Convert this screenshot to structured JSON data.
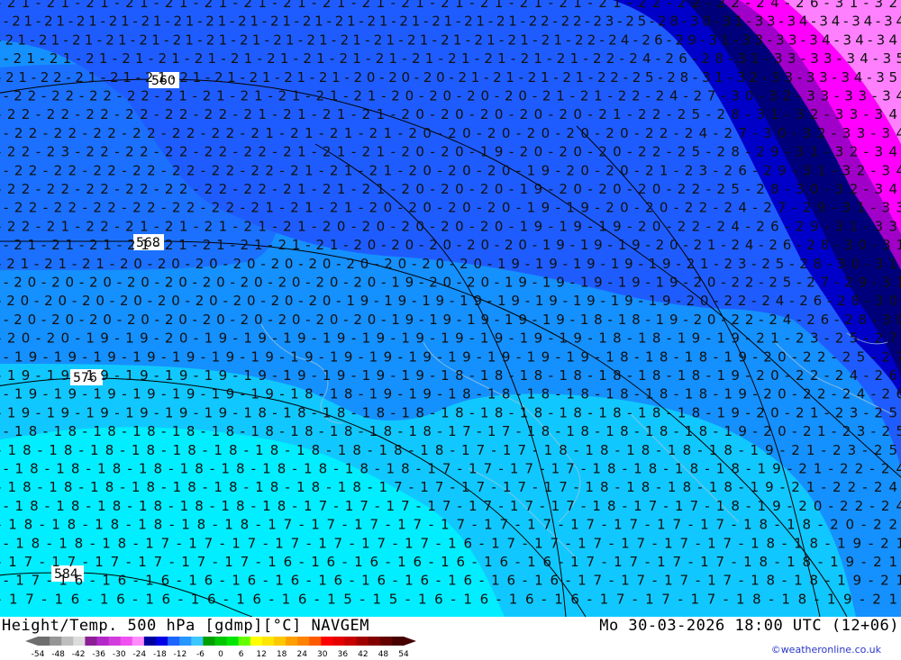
{
  "map": {
    "background_colors": {
      "m24": "#00007a",
      "m22": "#0000c8",
      "m20": "#1f5cff",
      "m18": "#1590ff",
      "m16": "#10c8ff",
      "m14": "#00eeff",
      "m26": "#a000c8",
      "m28": "#ff00ff",
      "m30": "#ff80ff"
    },
    "height_contours": [
      {
        "label": "560"
      },
      {
        "label": "568"
      },
      {
        "label": "576"
      },
      {
        "label": "584"
      }
    ],
    "temperature_rows": [
      "-21-21-21-21-21-21-21-21-21-21-21-21-21-21-21-21-22-22-22-24-26-31-32",
      "-21-21-21-21-21-21-21-21-21-21-21-21-21-21-21-21-22-22-23-25-28-30-31-33-34-34-34-34",
      "-21-21-21-21-21-21-21-21-21-21-21-21-21-21-21-21-21-22-24-26-29-31-33-33-34-34-34",
      "-21-21-21-21-21-21-21-21-21-21-21-21-21-21-21-21-22-24-26-28-31-33-33-34-35",
      "-21-22-21-21-21-21-21-21-21-21-20-20-20-21-21-21-21-22-25-28-31-32-33-33-34-35",
      "-22-22-22-22-21-21-21-21-21-21-20-20-20-20-21-21-22-24-27-30-32-33-33-34",
      "-22-22-22-22-22-22-21-21-21-21-20-20-20-20-20-21-22-25-28-31-32-33-34",
      "-22-22-22-22-22-22-21-21-21-21-20-20-20-20-20-20-22-24-27-30-32-33-34",
      "-22-23-22-22-22-22-22-21-21-21-20-20-19-20-20-20-22-25-28-29-31-32-34",
      "-22-22-22-22-22-22-22-21-21-21-20-20-20-19-20-20-21-23-26-29-31-32-34",
      "-22-22-22-22-22-22-22-21-21-21-20-20-20-19-20-20-20-22-25-28-30-32-34",
      "-22-22-22-22-22-22-21-21-21-20-20-20-20-19-19-20-20-22-24-27-29-31-33",
      "-22-21-22-21-21-21-21-21-20-20-20-20-20-19-19-19-20-22-24-26-29-31-33",
      "-21-21-21-21-21-21-21-21-21-20-20-20-20-20-19-19-19-20-21-24-26-28-30-31",
      "-21-21-21-20-20-20-20-20-20-20-20-20-20-19-19-19-19-19-21-23-25-28-30-31",
      "-20-20-20-20-20-20-20-20-20-20-19-20-20-19-19-19-19-19-20-22-25-27-29-31",
      "-20-20-20-20-20-20-20-20-20-19-19-19-19-19-19-19-19-19-20-22-24-26-28-30",
      "-20-20-20-20-20-20-20-20-20-20-19-19-19-19-19-18-18-19-20-22-24-26-28-30",
      "-20-20-19-19-20-19-19-19-19-19-19-19-19-19-19-18-18-19-19-21-23-25-27",
      "-19-19-19-19-19-19-19-19-19-19-19-19-19-19-19-18-18-18-19-20-22-25-27",
      "-19-19-19-19-19-19-19-19-19-19-19-18-18-18-18-18-18-18-19-20-22-24-26",
      "-19-19-19-19-19-19-19-18-18-19-19-18-18-18-18-18-18-18-19-20-22-24-26",
      "-19-19-19-19-19-19-18-18-18-18-18-18-18-18-18-18-18-18-19-20-21-23-25",
      "-18-18-18-18-18-18-18-18-18-18-18-17-17-18-18-18-18-18-19-20-21-23-25",
      "-18-18-18-18-18-18-18-18-18-18-18-17-17-18-18-18-18-18-19-21-23-25",
      "-18-18-18-18-18-18-18-18-18-18-17-17-17-17-18-18-18-18-19-21-22-24",
      "-18-18-18-18-18-18-18-18-18-17-17-17-17-17-18-18-18-18-19-21-22-24",
      "-18-18-18-18-18-18-18-17-17-17-17-17-17-17-18-17-17-18-19-20-22-24",
      "-18-18-18-18-18-18-17-17-17-17-17-17-17-17-17-17-17-18-18-20-22",
      "-18-18-18-17-17-17-17-17-17-17-16-17-17-17-17-17-17-18-18-19-21",
      "-17-17-17-17-17-17-16-16-16-16-16-16-16-17-17-17-17-18-18-19-21",
      "-17-16-16-16-16-16-16-16-16-16-16-16-16-17-17-17-17-18-18-19-21",
      "-17-16-16-16-16-16-16-15-15-16-16-16-16-17-17-17-18-18-19-21"
    ]
  },
  "footer": {
    "title": "Height/Temp. 500 hPa [gdmp][°C] NAVGEM",
    "datetime": "Mo 30-03-2026 18:00 UTC (12+06)",
    "credit": "©weatheronline.co.uk"
  },
  "legend": {
    "ticks": [
      "-54",
      "-48",
      "-42",
      "-36",
      "-30",
      "-24",
      "-18",
      "-12",
      "-6",
      "0",
      "6",
      "12",
      "18",
      "24",
      "30",
      "36",
      "42",
      "48",
      "54"
    ],
    "colors": [
      "#6e6e6e",
      "#969696",
      "#bebebe",
      "#dcdcdc",
      "#8c1e96",
      "#b428c8",
      "#d23cdc",
      "#f050f0",
      "#ff8cff",
      "#0000a0",
      "#0000e6",
      "#1e64ff",
      "#2896ff",
      "#3cc8ff",
      "#00a000",
      "#00c800",
      "#00e600",
      "#64ff00",
      "#ffff00",
      "#ffe600",
      "#ffc800",
      "#ffa000",
      "#ff8200",
      "#ff5a00",
      "#ff0000",
      "#e60000",
      "#c80000",
      "#a00000",
      "#820000",
      "#640000",
      "#460000"
    ]
  }
}
